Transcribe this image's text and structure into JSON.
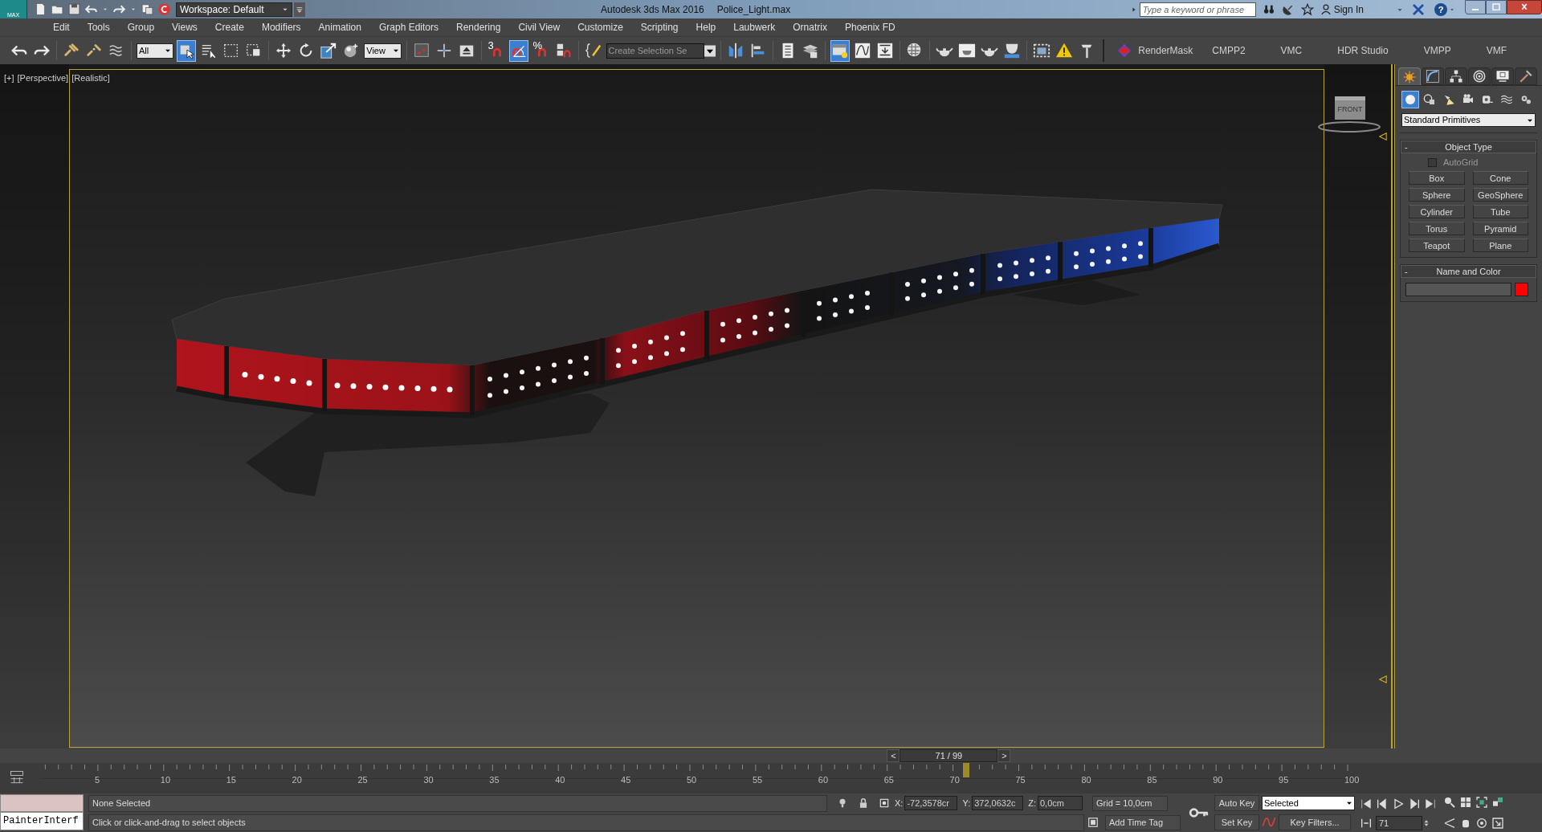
{
  "title_bar": {
    "logo_label": "MAX",
    "workspace": "Workspace: Default",
    "app_title": "Autodesk 3ds Max 2016",
    "file_name": "Police_Light.max",
    "search_placeholder": "Type a keyword or phrase",
    "sign_in": "Sign In",
    "help": "?"
  },
  "menu": [
    "Edit",
    "Tools",
    "Group",
    "Views",
    "Create",
    "Modifiers",
    "Animation",
    "Graph Editors",
    "Rendering",
    "Civil View",
    "Customize",
    "Scripting",
    "Help",
    "Laubwerk",
    "Ornatrix",
    "Phoenix FD"
  ],
  "main_toolbar": [
    {
      "kind": "button",
      "selected": false
    },
    {
      "kind": "button",
      "selected": false
    },
    {
      "kind": "button",
      "selected": false
    },
    {
      "kind": "button",
      "selected": false
    },
    {
      "kind": "button",
      "selected": false
    },
    {
      "kind": "dropdown",
      "value": "All"
    },
    {
      "kind": "button",
      "selected": true
    },
    {
      "kind": "button",
      "selected": false
    },
    {
      "kind": "button",
      "selected": false
    },
    {
      "kind": "button",
      "selected": false
    },
    {
      "kind": "button",
      "selected": false
    },
    {
      "kind": "button",
      "selected": false
    },
    {
      "kind": "button",
      "selected": false
    },
    {
      "kind": "button",
      "selected": false
    },
    {
      "kind": "dropdown",
      "value": "View"
    },
    {
      "kind": "button",
      "selected": false
    },
    {
      "kind": "button",
      "selected": false
    },
    {
      "kind": "button",
      "selected": false
    },
    {
      "kind": "button",
      "text": "3",
      "selected": false
    },
    {
      "kind": "button",
      "selected": true
    },
    {
      "kind": "button",
      "text": "%",
      "selected": false
    },
    {
      "kind": "button",
      "selected": false
    },
    {
      "kind": "button",
      "selected": false
    },
    {
      "kind": "field",
      "placeholder": "Create Selection Se"
    },
    {
      "kind": "button",
      "selected": false
    },
    {
      "kind": "button",
      "selected": false
    },
    {
      "kind": "button",
      "selected": false
    },
    {
      "kind": "button",
      "selected": false
    },
    {
      "kind": "button",
      "selected": true
    },
    {
      "kind": "button",
      "selected": false
    },
    {
      "kind": "button",
      "selected": false
    },
    {
      "kind": "button",
      "selected": false
    },
    {
      "kind": "button",
      "selected": false
    },
    {
      "kind": "button",
      "selected": false
    },
    {
      "kind": "button",
      "selected": false
    },
    {
      "kind": "button",
      "selected": false
    },
    {
      "kind": "button",
      "selected": false
    },
    {
      "kind": "button",
      "selected": false
    },
    {
      "kind": "button",
      "selected": false
    }
  ],
  "plugin_toolbar": [
    "RenderMask",
    "CMPP2",
    "VMC",
    "HDR Studio",
    "VMPP",
    "VMF"
  ],
  "viewport": {
    "labels": [
      "[+]",
      "[Perspective]",
      "[Realistic]"
    ],
    "viewcube_label": "FRONT"
  },
  "command_panel": {
    "tabs": [
      {
        "selected": true
      },
      {
        "selected": false
      },
      {
        "selected": false
      },
      {
        "selected": false
      },
      {
        "selected": false
      },
      {
        "selected": false
      }
    ],
    "categories": [
      {
        "selected": true
      },
      {
        "selected": false
      },
      {
        "selected": false
      },
      {
        "selected": false
      },
      {
        "selected": false
      },
      {
        "selected": false
      },
      {
        "selected": false
      }
    ],
    "dropdown": "Standard Primitives",
    "rollouts": [
      {
        "kind": "object_type",
        "toggle": "-",
        "title": "Object Type",
        "autogrid": {
          "label": "AutoGrid",
          "checked": false
        },
        "buttons": [
          "Box",
          "Cone",
          "Sphere",
          "GeoSphere",
          "Cylinder",
          "Tube",
          "Torus",
          "Pyramid",
          "Teapot",
          "Plane"
        ]
      },
      {
        "kind": "name_color",
        "toggle": "-",
        "title": "Name and Color",
        "color": "#ff0000"
      }
    ]
  },
  "timeline": {
    "prev": "<",
    "frame_label": "71 / 99",
    "next": ">",
    "level": 0.71,
    "ruler_labels": [
      "5",
      "10",
      "15",
      "20",
      "25",
      "30",
      "35",
      "40",
      "45",
      "50",
      "55",
      "60",
      "65",
      "70",
      "75",
      "80",
      "85",
      "90",
      "95",
      "100"
    ]
  },
  "status_bar": {
    "listener_label": "PainterInterf",
    "selection_info": "None Selected",
    "prompt": "Click or click-and-drag to select objects",
    "x_label": "X:",
    "x_value": "-72,3578cr",
    "y_label": "Y:",
    "y_value": "372,0632c",
    "z_label": "Z:",
    "z_value": "0,0cm",
    "grid": "Grid = 10,0cm",
    "add_time_tag": "Add Time Tag",
    "auto_key": "Auto Key",
    "key_mode": "Selected",
    "set_key": "Set Key",
    "key_filters": "Key Filters...",
    "current_frame": "71"
  }
}
